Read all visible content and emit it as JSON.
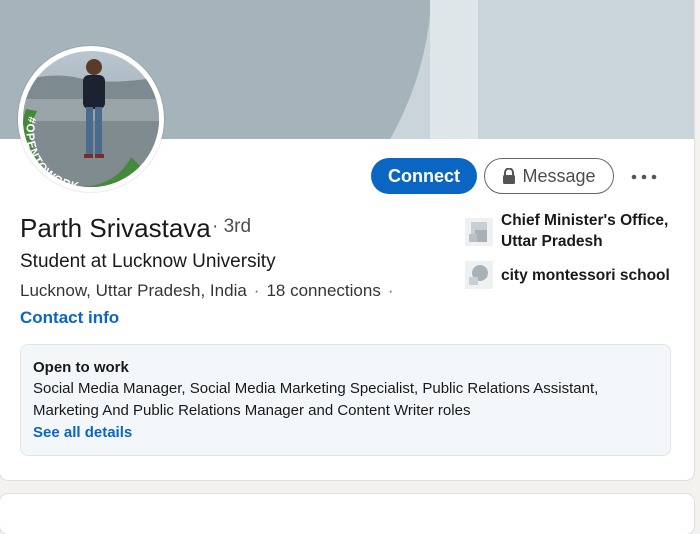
{
  "profile": {
    "name": "Parth Srivastava",
    "degree_sep": "·",
    "degree": "3rd",
    "headline": "Student at Lucknow University",
    "location": "Lucknow, Uttar Pradesh, India",
    "connections": "18 connections",
    "contact_info": "Contact info",
    "avatar_badge": "#OPENTOWORK"
  },
  "actions": {
    "connect_label": "Connect",
    "message_label": "Message",
    "more_icon": "more-horizontal-icon"
  },
  "experience": [
    {
      "label_line1": "Chief Minister's Office,",
      "label_line2": "Uttar Pradesh"
    },
    {
      "label_line1": "city montessori school"
    }
  ],
  "open_to_work": {
    "title": "Open to work",
    "roles_line1": "Social Media Manager, Social Media Marketing Specialist, Public Relations Assistant,",
    "roles_line2": "Marketing And Public Relations Manager and Content Writer roles",
    "see_details": "See all details"
  },
  "colors": {
    "primary": "#0a66c2",
    "open_to_work_green": "#448a3a",
    "cover": "#a5b4bb"
  }
}
